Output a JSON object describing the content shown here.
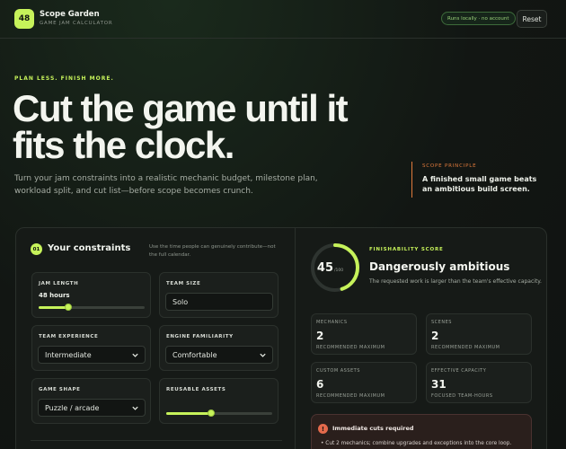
{
  "app": {
    "badge": "48",
    "name": "Scope Garden",
    "subtitle": "GAME JAM CALCULATOR",
    "status_pill": "Runs locally · no account",
    "reset_label": "Reset"
  },
  "hero": {
    "eyebrow": "PLAN LESS. FINISH MORE.",
    "headline_line1": "Cut the game until it",
    "headline_line2": "fits the clock.",
    "lede": "Turn your jam constraints into a realistic mechanic budget, milestone plan, workload split, and cut list—before scope becomes crunch."
  },
  "principle": {
    "label": "SCOPE PRINCIPLE",
    "text": "A finished small game beats an ambitious build screen."
  },
  "constraints": {
    "step": "01",
    "title": "Your constraints",
    "note": "Use the time people can genuinely contribute—not the full calendar.",
    "jam_length": {
      "label": "JAM LENGTH",
      "value": "48 hours",
      "fraction": 0.28
    },
    "team_size": {
      "label": "TEAM SIZE",
      "value": "Solo"
    },
    "team_experience": {
      "label": "TEAM EXPERIENCE",
      "value": "Intermediate"
    },
    "engine_familiarity": {
      "label": "ENGINE FAMILIARITY",
      "value": "Comfortable"
    },
    "game_shape": {
      "label": "GAME SHAPE",
      "value": "Puzzle / arcade"
    },
    "reusable_assets": {
      "label": "REUSABLE ASSETS",
      "fraction": 0.42
    }
  },
  "score": {
    "value": "45",
    "max": "/100",
    "fraction": 0.45,
    "label": "FINISHABILITY SCORE",
    "title": "Dangerously ambitious",
    "description": "The requested work is larger than the team's effective capacity.",
    "color": "#c6f25a"
  },
  "stats": [
    {
      "label": "MECHANICS",
      "value": "2",
      "sub": "RECOMMENDED MAXIMUM"
    },
    {
      "label": "SCENES",
      "value": "2",
      "sub": "RECOMMENDED MAXIMUM"
    },
    {
      "label": "CUSTOM ASSETS",
      "value": "6",
      "sub": "RECOMMENDED MAXIMUM"
    },
    {
      "label": "EFFECTIVE CAPACITY",
      "value": "31",
      "sub": "FOCUSED TEAM-HOURS"
    }
  ],
  "alert": {
    "icon": "!",
    "title": "Immediate cuts required",
    "items": [
      "Cut 2 mechanics; combine upgrades and exceptions into the core loop."
    ]
  }
}
